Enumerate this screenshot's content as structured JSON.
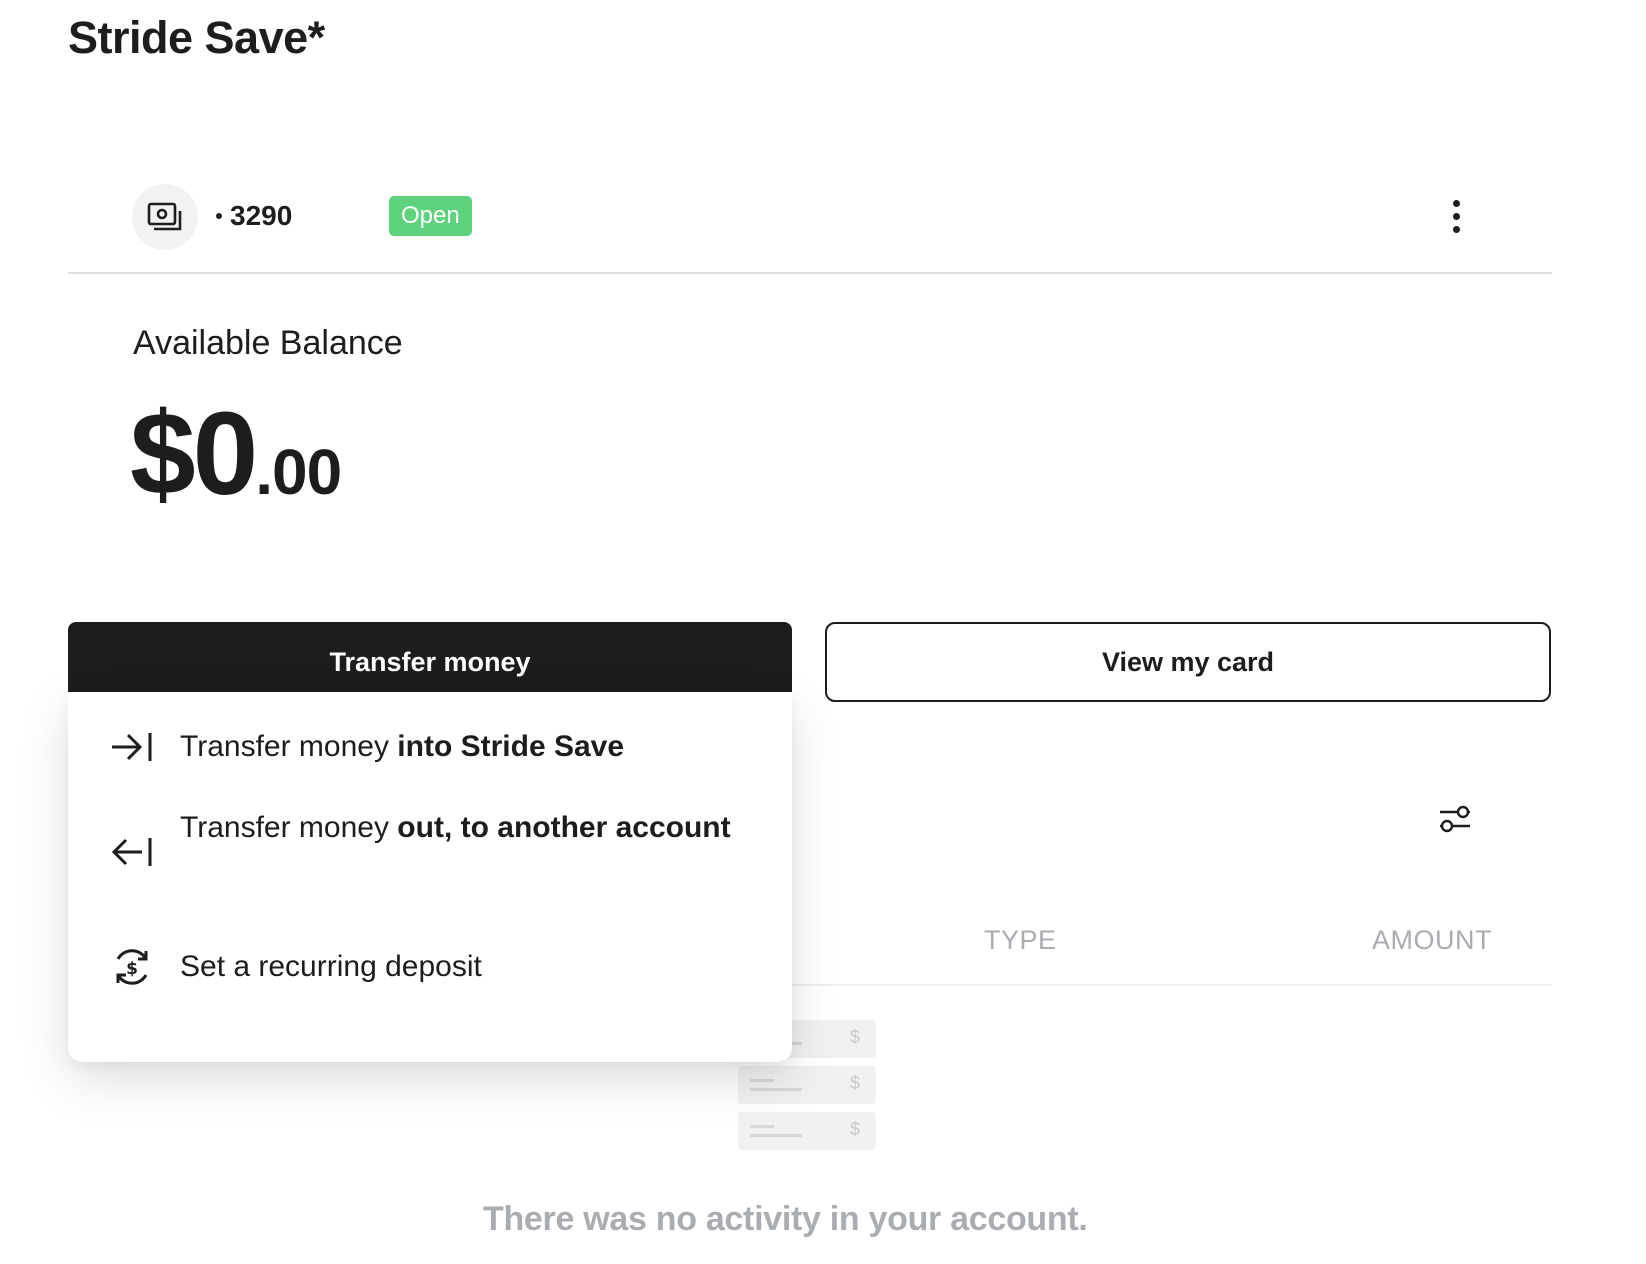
{
  "page": {
    "title": "Stride Save*"
  },
  "account": {
    "number": "3290",
    "status": "Open",
    "status_color": "#5fd27d",
    "icon": "cash-icon",
    "more_icon": "more-vertical-icon"
  },
  "balance": {
    "label": "Available Balance",
    "dollars": "$0",
    "cents": ".00"
  },
  "actions": {
    "transfer_label": "Transfer money",
    "view_card_label": "View my card"
  },
  "transfer_menu": {
    "items": [
      {
        "icon": "arrow-right-to-bar-icon",
        "text_regular": "Transfer money ",
        "text_bold": "into Stride Save"
      },
      {
        "icon": "arrow-left-from-bar-icon",
        "text_regular": "Transfer money ",
        "text_bold": "out, to another account"
      },
      {
        "icon": "recurring-dollar-icon",
        "text_regular": "Set a recurring deposit",
        "text_bold": ""
      }
    ]
  },
  "activity": {
    "filter_icon": "filter-sliders-icon",
    "columns": [
      "TYPE",
      "AMOUNT"
    ],
    "placeholder_symbol": "$",
    "empty_message": "There was no activity in your account."
  },
  "colors": {
    "primary_dark": "#1c1d1f",
    "muted_text": "#a9acb1",
    "badge_green": "#5fd27d"
  }
}
